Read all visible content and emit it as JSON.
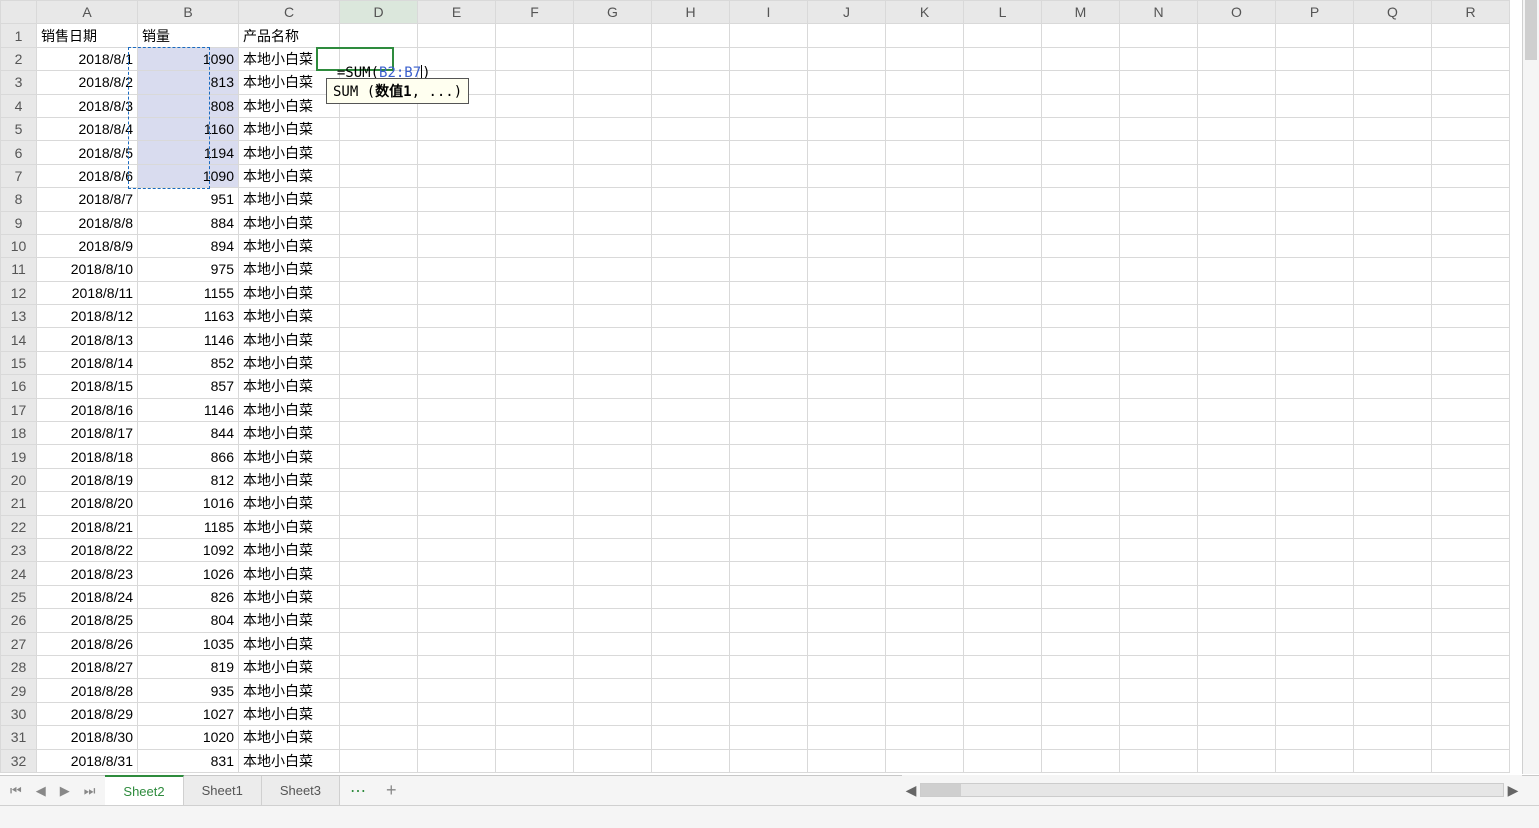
{
  "columns": [
    "A",
    "B",
    "C",
    "D",
    "E",
    "F",
    "G",
    "H",
    "I",
    "J",
    "K",
    "L",
    "M",
    "N",
    "O",
    "P",
    "Q",
    "R"
  ],
  "headers": {
    "A": "销售日期",
    "B": "销量",
    "C": "产品名称"
  },
  "rows": [
    {
      "n": 1
    },
    {
      "n": 2,
      "A": "2018/8/1",
      "B": "1090",
      "C": "本地小白菜"
    },
    {
      "n": 3,
      "A": "2018/8/2",
      "B": "813",
      "C": "本地小白菜"
    },
    {
      "n": 4,
      "A": "2018/8/3",
      "B": "808",
      "C": "本地小白菜"
    },
    {
      "n": 5,
      "A": "2018/8/4",
      "B": "1160",
      "C": "本地小白菜"
    },
    {
      "n": 6,
      "A": "2018/8/5",
      "B": "1194",
      "C": "本地小白菜"
    },
    {
      "n": 7,
      "A": "2018/8/6",
      "B": "1090",
      "C": "本地小白菜"
    },
    {
      "n": 8,
      "A": "2018/8/7",
      "B": "951",
      "C": "本地小白菜"
    },
    {
      "n": 9,
      "A": "2018/8/8",
      "B": "884",
      "C": "本地小白菜"
    },
    {
      "n": 10,
      "A": "2018/8/9",
      "B": "894",
      "C": "本地小白菜"
    },
    {
      "n": 11,
      "A": "2018/8/10",
      "B": "975",
      "C": "本地小白菜"
    },
    {
      "n": 12,
      "A": "2018/8/11",
      "B": "1155",
      "C": "本地小白菜"
    },
    {
      "n": 13,
      "A": "2018/8/12",
      "B": "1163",
      "C": "本地小白菜"
    },
    {
      "n": 14,
      "A": "2018/8/13",
      "B": "1146",
      "C": "本地小白菜"
    },
    {
      "n": 15,
      "A": "2018/8/14",
      "B": "852",
      "C": "本地小白菜"
    },
    {
      "n": 16,
      "A": "2018/8/15",
      "B": "857",
      "C": "本地小白菜"
    },
    {
      "n": 17,
      "A": "2018/8/16",
      "B": "1146",
      "C": "本地小白菜"
    },
    {
      "n": 18,
      "A": "2018/8/17",
      "B": "844",
      "C": "本地小白菜"
    },
    {
      "n": 19,
      "A": "2018/8/18",
      "B": "866",
      "C": "本地小白菜"
    },
    {
      "n": 20,
      "A": "2018/8/19",
      "B": "812",
      "C": "本地小白菜"
    },
    {
      "n": 21,
      "A": "2018/8/20",
      "B": "1016",
      "C": "本地小白菜"
    },
    {
      "n": 22,
      "A": "2018/8/21",
      "B": "1185",
      "C": "本地小白菜"
    },
    {
      "n": 23,
      "A": "2018/8/22",
      "B": "1092",
      "C": "本地小白菜"
    },
    {
      "n": 24,
      "A": "2018/8/23",
      "B": "1026",
      "C": "本地小白菜"
    },
    {
      "n": 25,
      "A": "2018/8/24",
      "B": "826",
      "C": "本地小白菜"
    },
    {
      "n": 26,
      "A": "2018/8/25",
      "B": "804",
      "C": "本地小白菜"
    },
    {
      "n": 27,
      "A": "2018/8/26",
      "B": "1035",
      "C": "本地小白菜"
    },
    {
      "n": 28,
      "A": "2018/8/27",
      "B": "819",
      "C": "本地小白菜"
    },
    {
      "n": 29,
      "A": "2018/8/28",
      "B": "935",
      "C": "本地小白菜"
    },
    {
      "n": 30,
      "A": "2018/8/29",
      "B": "1027",
      "C": "本地小白菜"
    },
    {
      "n": 31,
      "A": "2018/8/30",
      "B": "1020",
      "C": "本地小白菜"
    },
    {
      "n": 32,
      "A": "2018/8/31",
      "B": "831",
      "C": "本地小白菜"
    }
  ],
  "active_cell": "D2",
  "formula": {
    "prefix": "=SUM(",
    "ref": "B2:B7",
    "suffix": ")"
  },
  "tooltip": {
    "fn": "SUM",
    "open": " (",
    "arg": "数值1",
    "rest": ", ...)"
  },
  "selection_range": "B2:B7",
  "tabs": {
    "items": [
      "Sheet2",
      "Sheet1",
      "Sheet3"
    ],
    "active": 0,
    "menu": "⋯",
    "add": "+"
  },
  "nav": {
    "first": "⏮",
    "prev": "◀",
    "next": "▶",
    "last": "⏭"
  },
  "hscroll": {
    "left": "◀",
    "right": "▶"
  },
  "col_widths": {
    "row": 36,
    "A": 91,
    "B": 82,
    "C": 101,
    "other": 78
  }
}
